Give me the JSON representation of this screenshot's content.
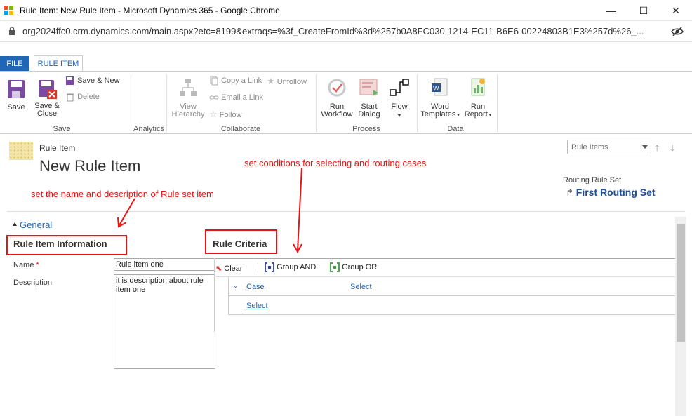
{
  "browser": {
    "window_title": "Rule Item: New Rule Item - Microsoft Dynamics 365 - Google Chrome",
    "url": "org2024ffc0.crm.dynamics.com/main.aspx?etc=8199&extraqs=%3f_CreateFromId%3d%257b0A8FC030-1214-EC11-B6E6-00224803B1E3%257d%26_...",
    "minimize": "—",
    "maximize": "☐",
    "close": "✕"
  },
  "ribbon_tabs": {
    "file": "FILE",
    "rule_item": "RULE ITEM"
  },
  "ribbon": {
    "save": "Save",
    "save_close_1": "Save &",
    "save_close_2": "Close",
    "save_new": "Save & New",
    "delete": "Delete",
    "group_save": "Save",
    "group_analytics": "Analytics",
    "view_hierarchy_1": "View",
    "view_hierarchy_2": "Hierarchy",
    "copy_link": "Copy a Link",
    "email_link": "Email a Link",
    "unfollow": "Unfollow",
    "follow": "Follow",
    "group_collaborate": "Collaborate",
    "run_workflow_1": "Run",
    "run_workflow_2": "Workflow",
    "start_dialog_1": "Start",
    "start_dialog_2": "Dialog",
    "flow": "Flow",
    "group_process": "Process",
    "word_templates_1": "Word",
    "word_templates_2": "Templates",
    "run_report_1": "Run",
    "run_report_2": "Report",
    "group_data": "Data"
  },
  "form": {
    "entity_type": "Rule Item",
    "title": "New Rule Item",
    "selector": "Rule Items",
    "parent_label": "Routing Rule Set",
    "parent_link": "First Routing Set",
    "tab_general": "General",
    "section_info": "Rule Item Information",
    "section_criteria": "Rule Criteria",
    "name_label": "Name",
    "required_mark": "*",
    "name_value": "Rule item one",
    "description_label": "Description",
    "description_value": "it is description about rule item one"
  },
  "criteria": {
    "clear": "Clear",
    "group_and": "Group AND",
    "group_or": "Group OR",
    "row1_field": "Case",
    "row1_select": "Select",
    "row2_select": "Select"
  },
  "annotations": {
    "conditions": "set conditions for selecting and routing cases",
    "name_desc": "set the name and description of Rule set item"
  },
  "colors": {
    "accent": "#2166b5",
    "annotation": "#ee1111",
    "file_tab": "#2166b5"
  }
}
